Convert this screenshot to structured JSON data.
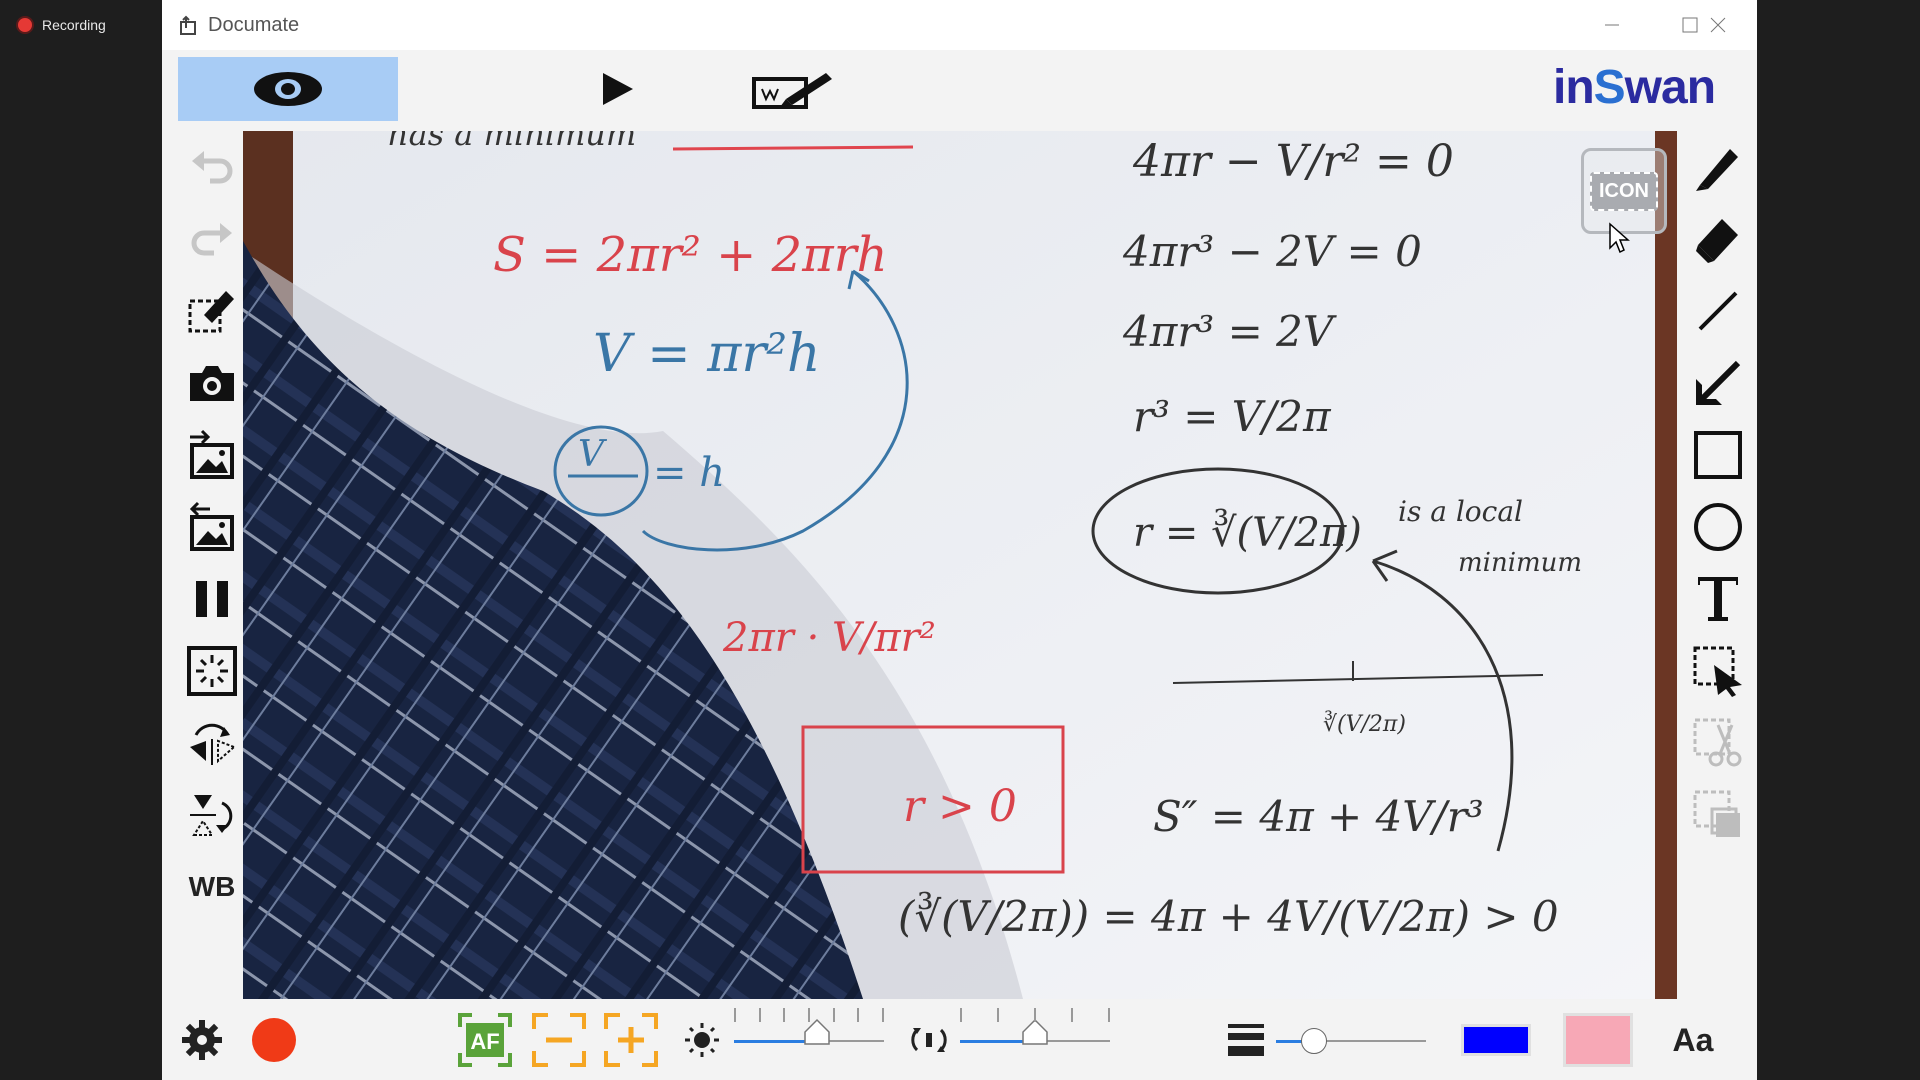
{
  "recording": {
    "label": "Recording",
    "dot_color": "#e53935"
  },
  "window": {
    "title": "Documate"
  },
  "toolbar": {
    "modes": [
      {
        "name": "camera-view",
        "icon": "eye-icon",
        "active": true
      },
      {
        "name": "playback",
        "icon": "play-icon",
        "active": false
      },
      {
        "name": "annotate",
        "icon": "whiteboard-pen-icon",
        "active": false
      }
    ],
    "brand": {
      "part1": "in",
      "part2": "S",
      "part3": "wan",
      "color": "#2b2ba0",
      "accent": "#2a6fd1"
    }
  },
  "left_tools": [
    "undo-icon",
    "redo-icon",
    "clear-annotations-icon",
    "snapshot-camera-icon",
    "import-image-icon",
    "export-image-icon",
    "pause-icon",
    "time-lapse-icon",
    "rotate-icon",
    "flip-icon"
  ],
  "left_wb_label": "WB",
  "right_tools": [
    "pen-icon",
    "eraser-icon",
    "line-icon",
    "arrow-icon",
    "rectangle-icon",
    "circle-icon",
    "text-icon",
    "select-icon",
    "cut-icon",
    "copy-icon"
  ],
  "overlay": {
    "icon_label": "ICON"
  },
  "bottom": {
    "record_color": "#f03a17",
    "af_label": "AF",
    "brightness_level": 0.55,
    "exposure_level": 0.5,
    "line_width_level": 0.25,
    "pen_color": "#0000ff",
    "fill_color": "#f7a8b6",
    "font_label": "Aa"
  }
}
